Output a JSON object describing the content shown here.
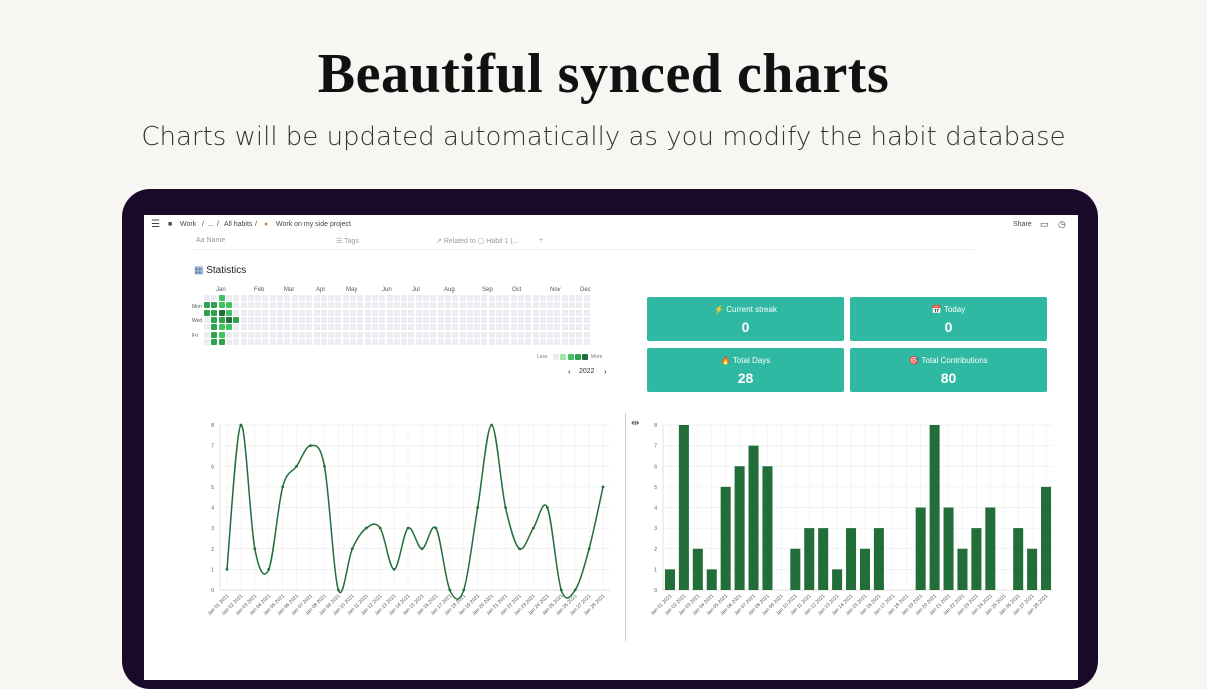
{
  "hero": {
    "title": "Beautiful synced charts",
    "subtitle": "Charts will be updated automatically as you modify the habit database"
  },
  "topbar": {
    "breadcrumb_work": "Work",
    "breadcrumb_sep1": "/",
    "breadcrumb_ellipsis": "...",
    "breadcrumb_sep2": "/",
    "breadcrumb_all_habits": "All habits",
    "breadcrumb_sep3": "/",
    "breadcrumb_page": "Work on my side project",
    "share_label": "Share"
  },
  "properties": {
    "name": "Name",
    "tags": "Tags",
    "related": "Related to",
    "habit": "Habit 1 (...",
    "add": "+"
  },
  "statistics": {
    "title": "Statistics",
    "months": [
      "Jan",
      "Feb",
      "Mar",
      "Apr",
      "May",
      "Jun",
      "Jul",
      "Aug",
      "Sep",
      "Oct",
      "Nov",
      "Dec"
    ],
    "day_labels": [
      "Mon",
      "Wed",
      "Fri"
    ],
    "legend_less": "Less",
    "legend_more": "More",
    "year": "2022",
    "prev": "‹",
    "next": "›",
    "heat_colors": [
      "#ebedf0",
      "#9be9a8",
      "#40c463",
      "#30a14e",
      "#216e39"
    ],
    "heat_levels": [
      [
        0,
        3,
        3,
        0,
        0,
        0,
        0
      ],
      [
        0,
        3,
        3,
        3,
        3,
        3,
        3
      ],
      [
        2,
        2,
        4,
        3,
        2,
        2,
        3
      ],
      [
        0,
        2,
        2,
        4,
        2,
        0,
        0
      ],
      [
        0,
        0,
        0,
        3,
        0,
        0,
        0
      ]
    ]
  },
  "cards": [
    {
      "icon": "⚡",
      "label": "Current streak",
      "value": "0"
    },
    {
      "icon": "📅",
      "label": "Today",
      "value": "0"
    },
    {
      "icon": "🔥",
      "label": "Total Days",
      "value": "28"
    },
    {
      "icon": "🎯",
      "label": "Total Contributions",
      "value": "80"
    }
  ],
  "colors": {
    "accent": "#2fb9a2",
    "series": "#216e39"
  },
  "chart_data": [
    {
      "type": "line",
      "x": [
        "Jan 01 2021",
        "Jan 02 2021",
        "Jan 03 2021",
        "Jan 04 2021",
        "Jan 05 2021",
        "Jan 06 2021",
        "Jan 07 2021",
        "Jan 08 2021",
        "Jan 09 2021",
        "Jan 10 2021",
        "Jan 11 2021",
        "Jan 12 2021",
        "Jan 13 2021",
        "Jan 14 2021",
        "Jan 15 2021",
        "Jan 16 2021",
        "Jan 17 2021",
        "Jan 18 2021",
        "Jan 19 2021",
        "Jan 20 2021",
        "Jan 21 2021",
        "Jan 22 2021",
        "Jan 23 2021",
        "Jan 24 2021",
        "Jan 25 2021",
        "Jan 26 2021",
        "Jan 27 2021",
        "Jan 28 2021"
      ],
      "values": [
        1,
        8,
        2,
        1,
        5,
        6,
        7,
        6,
        0,
        2,
        3,
        3,
        1,
        3,
        2,
        3,
        0,
        0,
        4,
        8,
        4,
        2,
        3,
        4,
        0,
        0,
        2,
        5
      ],
      "ylim": [
        0,
        8
      ],
      "yticks": [
        0,
        1,
        2,
        3,
        4,
        5,
        6,
        7,
        8
      ]
    },
    {
      "type": "bar",
      "x": [
        "Jan 01 2021",
        "Jan 02 2021",
        "Jan 03 2021",
        "Jan 04 2021",
        "Jan 05 2021",
        "Jan 06 2021",
        "Jan 07 2021",
        "Jan 08 2021",
        "Jan 09 2021",
        "Jan 10 2021",
        "Jan 11 2021",
        "Jan 12 2021",
        "Jan 13 2021",
        "Jan 14 2021",
        "Jan 15 2021",
        "Jan 16 2021",
        "Jan 17 2021",
        "Jan 18 2021",
        "Jan 19 2021",
        "Jan 20 2021",
        "Jan 21 2021",
        "Jan 22 2021",
        "Jan 23 2021",
        "Jan 24 2021",
        "Jan 25 2021",
        "Jan 26 2021",
        "Jan 27 2021",
        "Jan 28 2021"
      ],
      "values": [
        1,
        8,
        2,
        1,
        5,
        6,
        7,
        6,
        0,
        2,
        3,
        3,
        1,
        3,
        2,
        3,
        0,
        0,
        4,
        8,
        4,
        2,
        3,
        4,
        0,
        3,
        2,
        5
      ],
      "ylim": [
        0,
        8
      ],
      "yticks": [
        0,
        1,
        2,
        3,
        4,
        5,
        6,
        7,
        8
      ]
    }
  ]
}
